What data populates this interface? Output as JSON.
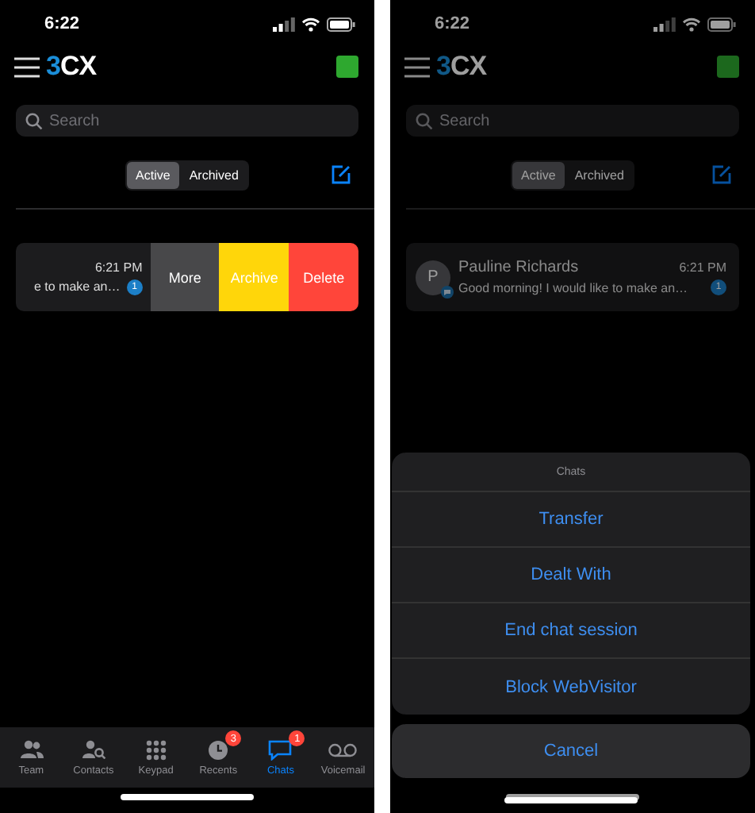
{
  "screens": [
    {
      "kind": "swipe",
      "dimmed": false,
      "time": "6:22",
      "logo": {
        "accent": "3",
        "rest": "CX"
      },
      "search": {
        "placeholder": "Search"
      },
      "segments": [
        {
          "label": "Active",
          "selected": true
        },
        {
          "label": "Archived",
          "selected": false
        }
      ],
      "chat": {
        "time": "6:21 PM",
        "preview": "e to make an…",
        "unread": "1"
      },
      "swipe_actions": [
        {
          "label": "More",
          "color": "#48484a"
        },
        {
          "label": "Archive",
          "color": "#ffd60a"
        },
        {
          "label": "Delete",
          "color": "#ff453a"
        }
      ],
      "tab_bar": [
        {
          "label": "Team",
          "selected": false
        },
        {
          "label": "Contacts",
          "selected": false
        },
        {
          "label": "Keypad",
          "selected": false
        },
        {
          "label": "Recents",
          "selected": false,
          "badge": "3"
        },
        {
          "label": "Chats",
          "selected": true,
          "badge": "1"
        },
        {
          "label": "Voicemail",
          "selected": false
        }
      ]
    },
    {
      "kind": "sheet",
      "dimmed": true,
      "time": "6:22",
      "logo": {
        "accent": "3",
        "rest": "CX"
      },
      "search": {
        "placeholder": "Search"
      },
      "segments": [
        {
          "label": "Active",
          "selected": true
        },
        {
          "label": "Archived",
          "selected": false
        }
      ],
      "chat": {
        "avatar": "P",
        "name": "Pauline Richards",
        "time": "6:21 PM",
        "preview": "Good morning! I would like to make an…",
        "unread": "1"
      },
      "action_sheet": {
        "title": "Chats",
        "actions": [
          "Transfer",
          "Dealt With",
          "End chat session",
          "Block WebVisitor"
        ],
        "cancel": "Cancel"
      }
    }
  ]
}
